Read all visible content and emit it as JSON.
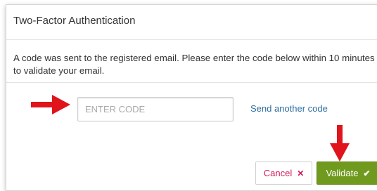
{
  "dialog": {
    "title": "Two-Factor Authentication",
    "message_line1": "A code was sent to the registered email. Please enter the code below within 10 minutes",
    "message_line2": "to validate your email."
  },
  "form": {
    "code_placeholder": "ENTER CODE",
    "code_value": "",
    "send_another_label": "Send another code"
  },
  "buttons": {
    "cancel_label": "Cancel",
    "cancel_icon": "close-icon",
    "validate_label": "Validate",
    "validate_icon": "check-icon"
  },
  "colors": {
    "cancel_text": "#d1195a",
    "validate_bg": "#6f9a1d",
    "link": "#2f6e9f",
    "annotation_arrow": "#e0141b"
  }
}
